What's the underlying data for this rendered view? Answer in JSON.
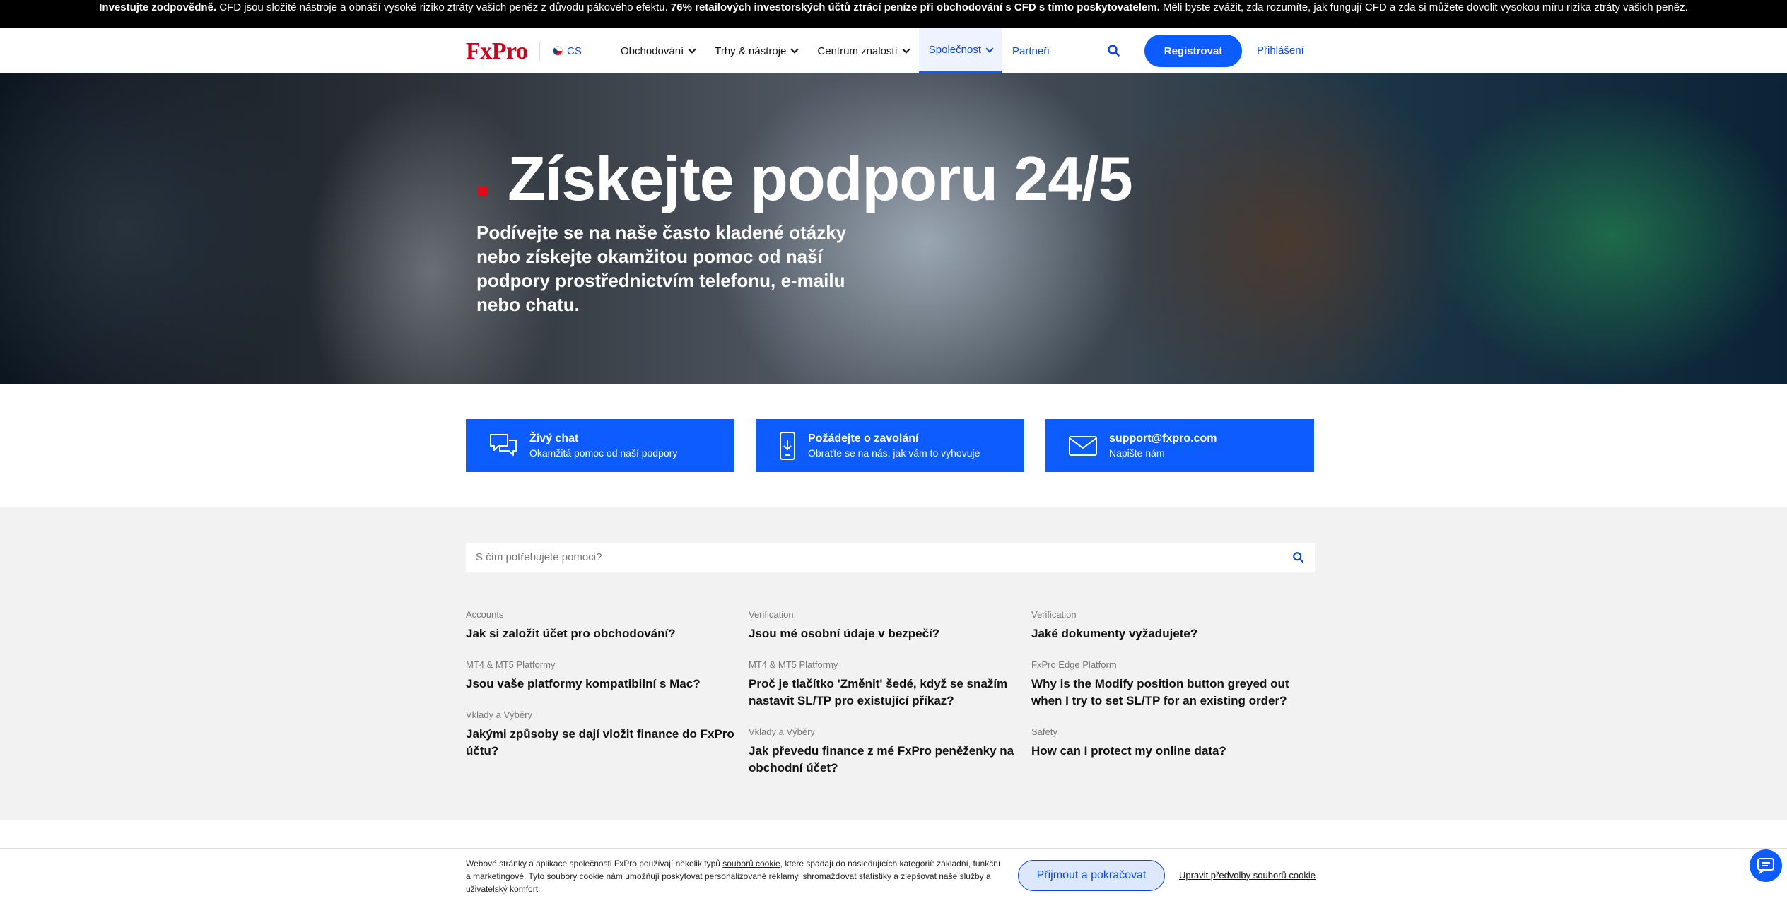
{
  "risk_banner": {
    "bold1": "Investujte zodpovědně.",
    "text1": " CFD jsou složité nástroje a obnáší vysoké riziko ztráty vašich peněz z důvodu pákového efektu. ",
    "bold2": "76% retailových investorských účtů ztrácí peníze při obchodování s CFD s tímto poskytovatelem.",
    "text2": " Měli byste zvážit, zda rozumíte, jak fungují CFD a zda si můžete dovolit vysokou míru rizika ztráty vašich peněz."
  },
  "header": {
    "logo": "FxPro",
    "language": "CS",
    "nav": [
      {
        "label": "Obchodování"
      },
      {
        "label": "Trhy & nástroje"
      },
      {
        "label": "Centrum znalostí"
      },
      {
        "label": "Společnost"
      }
    ],
    "partners": "Partneři",
    "register": "Registrovat",
    "login": "Přihlášení"
  },
  "hero": {
    "title": "Získejte podporu 24/5",
    "subtitle": "Podívejte se na naše často kladené otázky nebo získejte okamžitou pomoc od naší podpory prostřednictvím telefonu, e-mailu nebo chatu."
  },
  "contact_cards": [
    {
      "title": "Živý chat",
      "subtitle": "Okamžitá pomoc od naší podpory",
      "icon": "chat-bubbles-icon"
    },
    {
      "title": "Požádejte o zavolání",
      "subtitle": "Obraťte se na nás, jak vám to vyhovuje",
      "icon": "phone-download-icon"
    },
    {
      "title": "support@fxpro.com",
      "subtitle": "Napište nám",
      "icon": "envelope-icon"
    }
  ],
  "faq": {
    "search_placeholder": "S čím potřebujete pomoci?",
    "columns": [
      [
        {
          "category": "Accounts",
          "question": "Jak si založit účet pro obchodování?"
        },
        {
          "category": "MT4 & MT5 Platformy",
          "question": "Jsou vaše platformy kompatibilní s Mac?"
        },
        {
          "category": "Vklady a Výběry",
          "question": "Jakými způsoby se dají vložit finance do FxPro účtu?"
        }
      ],
      [
        {
          "category": "Verification",
          "question": "Jsou mé osobní údaje v bezpečí?"
        },
        {
          "category": "MT4 & MT5 Platformy",
          "question": "Proč je tlačítko 'Změnit' šedé, když se snažím nastavit SL/TP pro existující příkaz?"
        },
        {
          "category": "Vklady a Výběry",
          "question": "Jak převedu finance z mé FxPro peněženky na obchodní účet?"
        }
      ],
      [
        {
          "category": "Verification",
          "question": "Jaké dokumenty vyžadujete?"
        },
        {
          "category": "FxPro Edge Platform",
          "question": "Why is the Modify position button greyed out when I try to set SL/TP for an existing order?"
        },
        {
          "category": "Safety",
          "question": "How can I protect my online data?"
        }
      ]
    ]
  },
  "cookie": {
    "text_before": "Webové stránky a aplikace společnosti FxPro používají několik typů ",
    "link": "souborů cookie",
    "text_after": ", které spadají do následujících kategorií: základní, funkční a marketingové. Tyto soubory cookie nám umožňují poskytovat personalizované reklamy, shromažďovat statistiky a zlepšovat naše služby a uživatelský komfort.",
    "accept": "Přijmout a pokračovat",
    "preferences": "Upravit předvolby souborů cookie"
  },
  "colors": {
    "brand_red": "#d0021b",
    "accent_blue": "#0d5cff",
    "faq_bg": "#f2f2f2"
  }
}
